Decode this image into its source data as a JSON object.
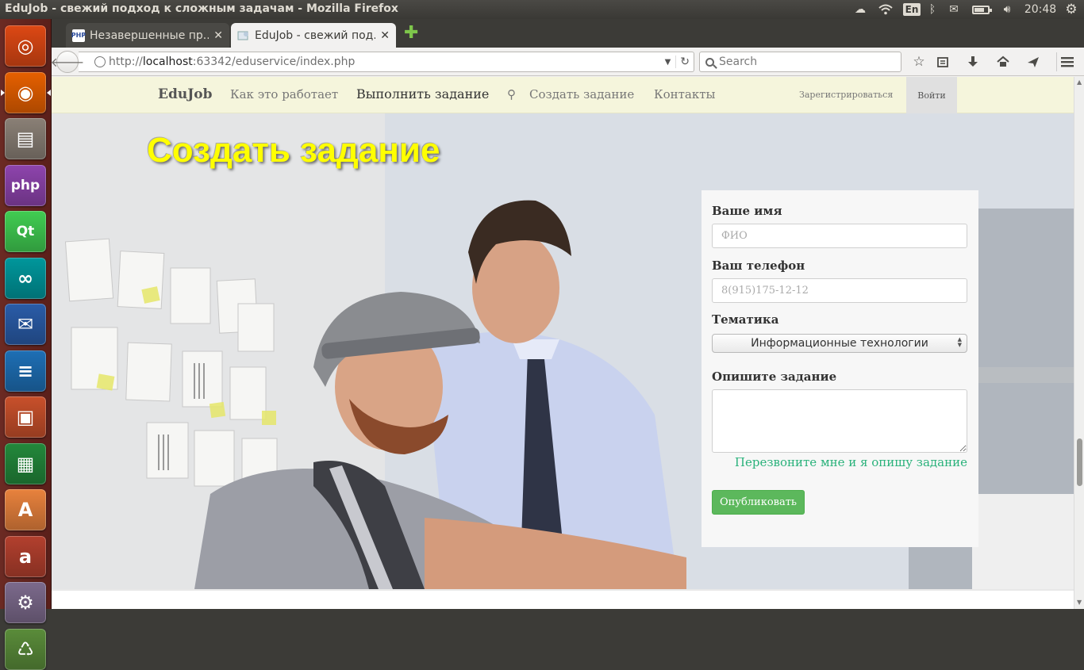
{
  "window": {
    "title": "EduJob - свежий подход к сложным задачам - Mozilla Firefox"
  },
  "panel": {
    "lang": "En",
    "clock": "20:48"
  },
  "launcher": {
    "items": [
      {
        "name": "ubuntu-dash-icon",
        "color": "#dd4814",
        "glyph": "◎"
      },
      {
        "name": "firefox-icon",
        "color": "#e66000",
        "glyph": "◉"
      },
      {
        "name": "files-icon",
        "color": "#8a8076",
        "glyph": "▤"
      },
      {
        "name": "phpstorm-icon",
        "color": "#8e44ad",
        "glyph": "php"
      },
      {
        "name": "qt-creator-icon",
        "color": "#41cd52",
        "glyph": "Qt"
      },
      {
        "name": "arduino-icon",
        "color": "#00979c",
        "glyph": "∞"
      },
      {
        "name": "thunderbird-icon",
        "color": "#2a5ca8",
        "glyph": "✉"
      },
      {
        "name": "writer-icon",
        "color": "#1e6fb5",
        "glyph": "≡"
      },
      {
        "name": "impress-icon",
        "color": "#c8502b",
        "glyph": "▣"
      },
      {
        "name": "calc-icon",
        "color": "#23883b",
        "glyph": "▦"
      },
      {
        "name": "software-center-icon",
        "color": "#e8823d",
        "glyph": "A"
      },
      {
        "name": "amazon-icon",
        "color": "#b3402e",
        "glyph": "a"
      },
      {
        "name": "system-settings-icon",
        "color": "#7c6a8c",
        "glyph": "⚙"
      },
      {
        "name": "trash-icon",
        "color": "#5a8c3a",
        "glyph": "♺"
      }
    ]
  },
  "tabs": [
    {
      "label": "Незавершенные пр...",
      "favicon": "PHP"
    },
    {
      "label": "EduJob - свежий под...",
      "favicon": ""
    }
  ],
  "address_bar": {
    "url_prefix": "http://",
    "url_host": "localhost",
    "url_rest": ":63342/eduservice/index.php"
  },
  "search": {
    "placeholder": "Search"
  },
  "site": {
    "brand": "EduJob",
    "nav": {
      "how": "Как это работает",
      "do_task": "Выполнить задание",
      "create": "Создать задание",
      "contacts": "Контакты",
      "register": "Зарегистрироваться",
      "login": "Войти"
    },
    "hero_title": "Создать задание",
    "form": {
      "name_label": "Ваше имя",
      "name_placeholder": "ФИО",
      "phone_label": "Ваш телефон",
      "phone_placeholder": "8(915)175-12-12",
      "topic_label": "Тематика",
      "topic_value": "Информационные технологии",
      "describe_label": "Опишите задание",
      "callback_link": "Перезвоните мне и я опишу задание",
      "publish_button": "Опубликовать"
    }
  }
}
